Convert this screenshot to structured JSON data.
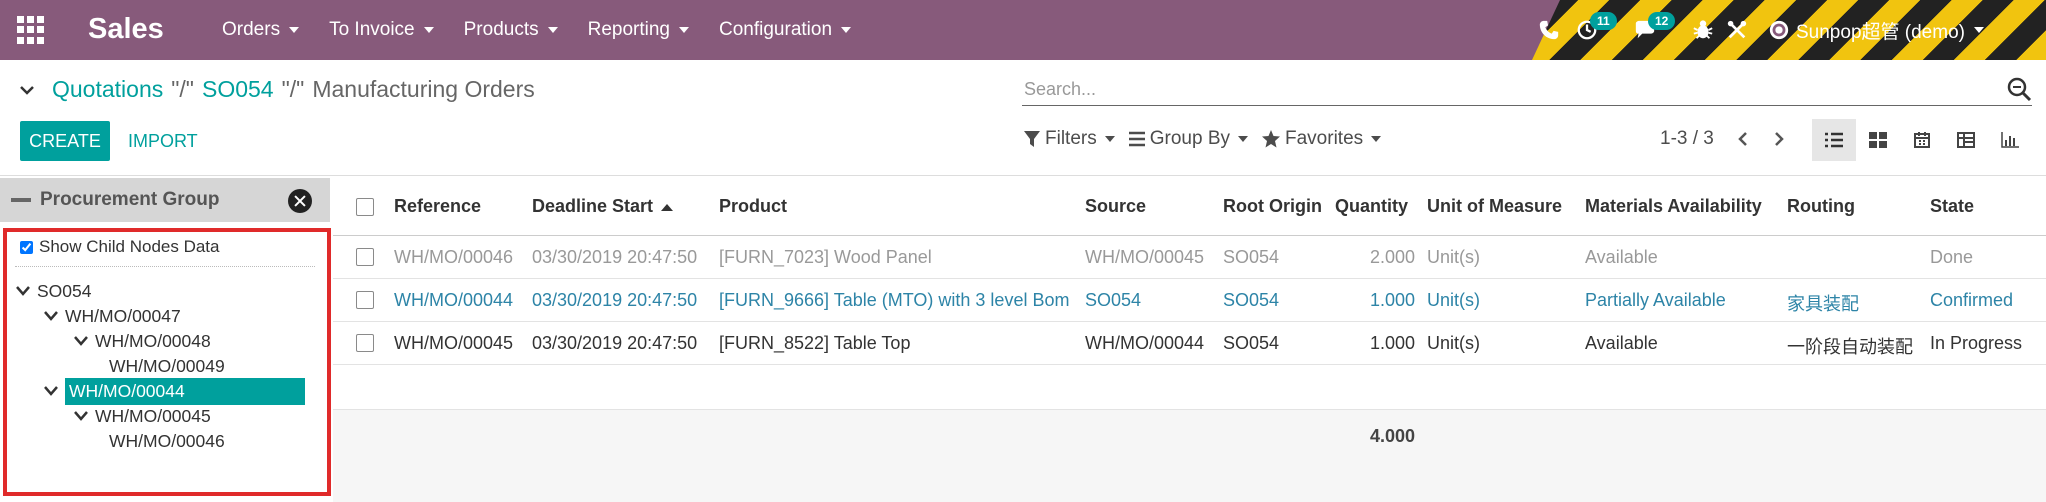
{
  "navbar": {
    "brand": "Sales",
    "menu": [
      "Orders",
      "To Invoice",
      "Products",
      "Reporting",
      "Configuration"
    ],
    "activity_count": "11",
    "message_count": "12",
    "user_name": "Sunpop超管 (demo)"
  },
  "breadcrumb": {
    "items": [
      "Quotations",
      "SO054"
    ],
    "separator": "\"/\"",
    "current": "Manufacturing Orders"
  },
  "search": {
    "placeholder": "Search..."
  },
  "buttons": {
    "create": "CREATE",
    "import": "IMPORT"
  },
  "filters": {
    "filters": "Filters",
    "group_by": "Group By",
    "favorites": "Favorites"
  },
  "pager": {
    "value": "1-3 / 3"
  },
  "side_panel": {
    "title": "Procurement Group",
    "show_child": "Show Child Nodes Data",
    "tree": [
      "SO054",
      "WH/MO/00047",
      "WH/MO/00048",
      "WH/MO/00049",
      "WH/MO/00044",
      "WH/MO/00045",
      "WH/MO/00046"
    ]
  },
  "table": {
    "columns": [
      "Reference",
      "Deadline Start",
      "Product",
      "Source",
      "Root Origin",
      "Quantity",
      "Unit of Measure",
      "Materials Availability",
      "Routing",
      "State"
    ],
    "rows": [
      [
        "WH/MO/00046",
        "03/30/2019 20:47:50",
        "[FURN_7023] Wood Panel",
        "WH/MO/00045",
        "SO054",
        "2.000",
        "Unit(s)",
        "Available",
        "",
        "Done"
      ],
      [
        "WH/MO/00044",
        "03/30/2019 20:47:50",
        "[FURN_9666] Table (MTO) with 3 level Bom",
        "SO054",
        "SO054",
        "1.000",
        "Unit(s)",
        "Partially Available",
        "家具装配",
        "Confirmed"
      ],
      [
        "WH/MO/00045",
        "03/30/2019 20:47:50",
        "[FURN_8522] Table Top",
        "WH/MO/00044",
        "SO054",
        "1.000",
        "Unit(s)",
        "Available",
        "一阶段自动装配",
        "In Progress"
      ]
    ],
    "total_quantity": "4.000"
  },
  "colors": {
    "brand": "#875a7b",
    "accent": "#00a09d",
    "highlight_border": "#e02a2a"
  }
}
